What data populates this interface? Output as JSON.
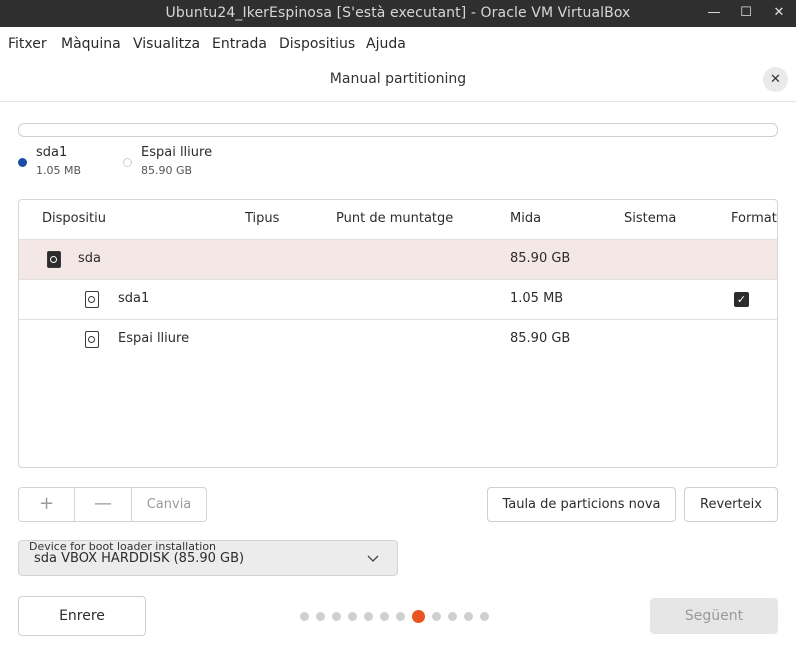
{
  "window": {
    "title": "Ubuntu24_IkerEspinosa [S'està executant] - Oracle VM VirtualBox",
    "minimize_glyph": "—",
    "maximize_glyph": "☐",
    "close_glyph": "✕"
  },
  "menubar": {
    "items": [
      "Fitxer",
      "Màquina",
      "Visualitza",
      "Entrada",
      "Dispositius",
      "Ajuda"
    ]
  },
  "dialog": {
    "title": "Manual partitioning",
    "close_glyph": "✕"
  },
  "usage_legend": [
    {
      "name": "sda1",
      "size": "1.05 MB",
      "color": "#1b4ca6"
    },
    {
      "name": "Espai lliure",
      "size": "85.90 GB",
      "color": "#ffffff"
    }
  ],
  "table": {
    "columns": [
      "Dispositiu",
      "Tipus",
      "Punt de muntatge",
      "Mida",
      "Sistema",
      "Format"
    ],
    "rows": [
      {
        "device": "sda",
        "type": "",
        "mount": "",
        "size": "85.90 GB",
        "system": "",
        "format": "",
        "selected": true,
        "icon": "disk-icon"
      },
      {
        "device": "sda1",
        "type": "",
        "mount": "",
        "size": "1.05 MB",
        "system": "",
        "format": "checked",
        "selected": false,
        "icon": "partition-icon"
      },
      {
        "device": "Espai lliure",
        "type": "",
        "mount": "",
        "size": "85.90 GB",
        "system": "",
        "format": "",
        "selected": false,
        "icon": "partition-icon"
      }
    ],
    "check_glyph": "✓"
  },
  "controls": {
    "add_glyph": "+",
    "remove_glyph": "—",
    "change_label": "Canvia",
    "new_table_label": "Taula de particions nova",
    "revert_label": "Reverteix"
  },
  "bootloader": {
    "label": "Device for boot loader installation",
    "value": "sda VBOX HARDDISK (85.90 GB)"
  },
  "footer": {
    "back_label": "Enrere",
    "next_label": "Següent",
    "page_count": 12,
    "active_page": 8
  },
  "colors": {
    "accent": "#e95420",
    "selected_row": "#f3e8e5",
    "titlebar": "#2f2f2f"
  }
}
